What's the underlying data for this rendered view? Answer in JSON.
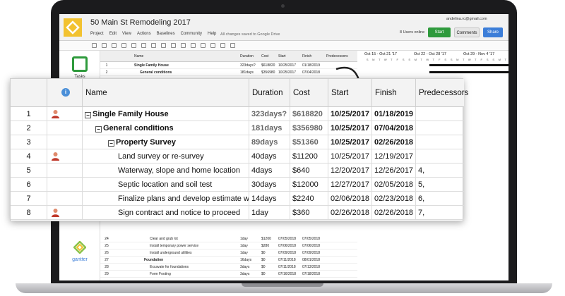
{
  "app": {
    "title": "50 Main St Remodeling 2017",
    "menu": [
      "Project",
      "Edit",
      "View",
      "Actions",
      "Baselines",
      "Community",
      "Help"
    ],
    "saved_message": "All changes saved to Google Drive",
    "user_email": "andelina.rc@gmail.com",
    "users_online": "8 Users online",
    "start_label": "Start",
    "comments_label": "Comments",
    "share_label": "Share",
    "brand_color": "#f2c230",
    "accent_green": "#2e9a3c",
    "accent_blue": "#3b7dd8"
  },
  "sidebar": {
    "tasks_label": "Tasks",
    "brand_label": "gantter"
  },
  "small_grid": {
    "headers": {
      "name": "Name",
      "duration": "Duration",
      "cost": "Cost",
      "start": "Start",
      "finish": "Finish",
      "predecessors": "Predecessors"
    },
    "top_rows": [
      {
        "num": "1",
        "name": "Single Family House",
        "duration": "323days?",
        "cost": "$618820",
        "start": "10/25/2017",
        "finish": "01/18/2019"
      },
      {
        "num": "2",
        "name": "General conditions",
        "duration": "181days",
        "cost": "$356980",
        "start": "10/25/2017",
        "finish": "07/04/2018"
      }
    ],
    "bottom_rows": [
      {
        "num": "24",
        "name": "Clear and grub lot",
        "duration": "1day",
        "cost": "$1200",
        "start": "07/05/2018",
        "finish": "07/05/2018",
        "pred": ""
      },
      {
        "num": "25",
        "name": "Install temporary power service",
        "duration": "1day",
        "cost": "$280",
        "start": "07/06/2018",
        "finish": "07/06/2018",
        "pred": ""
      },
      {
        "num": "26",
        "name": "Install underground utilities",
        "duration": "1day",
        "cost": "$0",
        "start": "07/09/2018",
        "finish": "07/09/2018",
        "pred": ""
      },
      {
        "num": "27",
        "name": "Foundation",
        "duration": "16days",
        "cost": "$0",
        "start": "07/11/2018",
        "finish": "08/01/2018",
        "pred": ""
      },
      {
        "num": "28",
        "name": "Excavate for foundations",
        "duration": "3days",
        "cost": "$0",
        "start": "07/11/2018",
        "finish": "07/13/2018",
        "pred": ""
      },
      {
        "num": "29",
        "name": "Form Footing",
        "duration": "3days",
        "cost": "$0",
        "start": "07/16/2018",
        "finish": "07/18/2018",
        "pred": ""
      }
    ]
  },
  "gantt": {
    "weeks": [
      "Oct 15 - Oct 21 '17",
      "Oct 22 - Oct 28 '17",
      "Oct 29 - Nov 4 '17"
    ],
    "days": [
      "S",
      "M",
      "T",
      "W",
      "T",
      "F",
      "S",
      "S",
      "M",
      "T",
      "W",
      "T",
      "F",
      "S",
      "S",
      "M",
      "T",
      "W",
      "T",
      "F",
      "S",
      "S",
      "M",
      "T"
    ]
  },
  "table": {
    "headers": {
      "name": "Name",
      "duration": "Duration",
      "cost": "Cost",
      "start": "Start",
      "finish": "Finish",
      "predecessors": "Predecessors"
    },
    "rows": [
      {
        "num": "1",
        "name": "Single Family House",
        "duration": "323days?",
        "cost": "$618820",
        "start": "10/25/2017",
        "finish": "01/18/2019",
        "pred": ""
      },
      {
        "num": "2",
        "name": "General conditions",
        "duration": "181days",
        "cost": "$356980",
        "start": "10/25/2017",
        "finish": "07/04/2018",
        "pred": ""
      },
      {
        "num": "3",
        "name": "Property Survey",
        "duration": "89days",
        "cost": "$51360",
        "start": "10/25/2017",
        "finish": "02/26/2018",
        "pred": ""
      },
      {
        "num": "4",
        "name": "Land survey or re-survey",
        "duration": "40days",
        "cost": "$11200",
        "start": "10/25/2017",
        "finish": "12/19/2017",
        "pred": ""
      },
      {
        "num": "5",
        "name": "Waterway, slope and home location",
        "duration": "4days",
        "cost": "$640",
        "start": "12/20/2017",
        "finish": "12/26/2017",
        "pred": "4,"
      },
      {
        "num": "6",
        "name": "Septic location and soil test",
        "duration": "30days",
        "cost": "$12000",
        "start": "12/27/2017",
        "finish": "02/05/2018",
        "pred": "5,"
      },
      {
        "num": "7",
        "name": "Finalize plans and develop estimate with",
        "duration": "14days",
        "cost": "$2240",
        "start": "02/06/2018",
        "finish": "02/23/2018",
        "pred": "6,"
      },
      {
        "num": "8",
        "name": "Sign contract and notice to proceed",
        "duration": "1day",
        "cost": "$360",
        "start": "02/26/2018",
        "finish": "02/26/2018",
        "pred": "7,"
      }
    ]
  }
}
